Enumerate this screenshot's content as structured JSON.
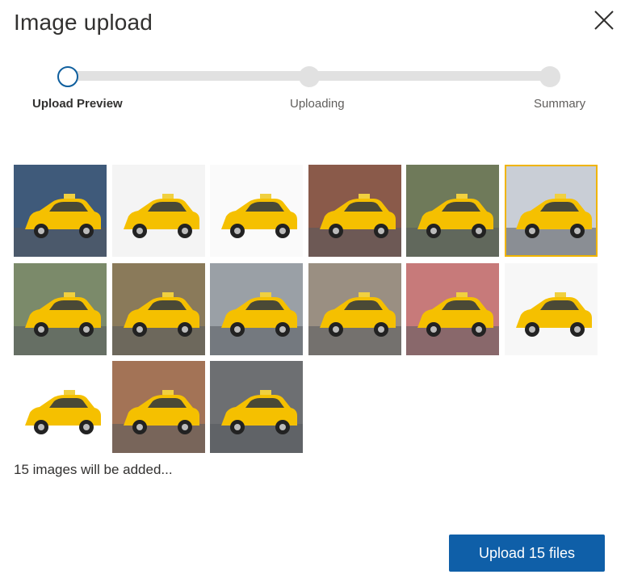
{
  "dialog": {
    "title": "Image upload",
    "close_icon": "close-icon"
  },
  "stepper": {
    "steps": [
      {
        "label": "Upload Preview",
        "state": "active"
      },
      {
        "label": "Uploading",
        "state": "pending"
      },
      {
        "label": "Summary",
        "state": "pending"
      }
    ],
    "progress_fraction": 0
  },
  "thumbnails": {
    "count": 15,
    "selected_index": 5,
    "images": [
      {
        "name": "taxi-motion-blur",
        "bg": "#3f5a7a"
      },
      {
        "name": "taxi-studio-white",
        "bg": "#f4f4f4"
      },
      {
        "name": "taxi-stock-render",
        "bg": "#fafafa"
      },
      {
        "name": "taxis-times-square",
        "bg": "#8a5a4a"
      },
      {
        "name": "taxis-city-street",
        "bg": "#6f7a5a"
      },
      {
        "name": "checker-cab-grey-sky",
        "bg": "#c9ced6"
      },
      {
        "name": "ambassador-taxi-street",
        "bg": "#7b8a6a"
      },
      {
        "name": "ambassador-taxi-alley",
        "bg": "#8a7a5a"
      },
      {
        "name": "checker-cab-lot",
        "bg": "#9aa0a6"
      },
      {
        "name": "checker-cab-street",
        "bg": "#9a8f82"
      },
      {
        "name": "ambassador-taxi-pink-wall",
        "bg": "#c77a7a"
      },
      {
        "name": "taxi-cartoon-white",
        "bg": "#f7f7f7"
      },
      {
        "name": "two-taxi-illustrations",
        "bg": "#ffffff"
      },
      {
        "name": "ambassador-taxis-crowd",
        "bg": "#a37356"
      },
      {
        "name": "taxi-crown-victoria",
        "bg": "#6d6f72"
      }
    ]
  },
  "status": {
    "text": "15 images will be added..."
  },
  "footer": {
    "upload_label": "Upload 15 files"
  },
  "colors": {
    "accent": "#0f5fa8",
    "selected_outline": "#f0b400",
    "taxi_yellow": "#f5c000"
  }
}
